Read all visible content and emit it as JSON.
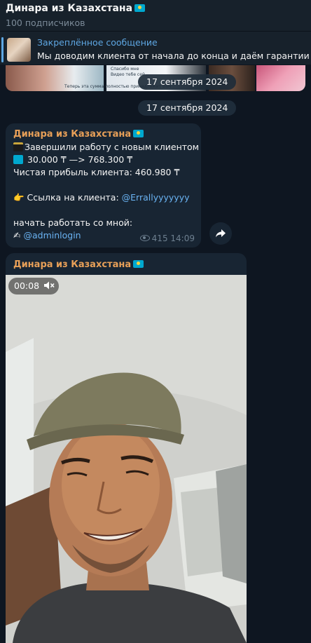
{
  "header": {
    "title": "Динара из Казахстана",
    "subscribers": "100 подписчиков"
  },
  "pinned": {
    "label": "Закреплённое сообщение",
    "text": "Мы доводим клиента от начала до конца и даём гарантии"
  },
  "album": {
    "date_badge": "17 сентября 2024",
    "snippets": [
      "Теперь эта сумма полностью принадлежит Вам",
      "Видео тебе сей",
      "Спасибо мне"
    ]
  },
  "date_separator": "17 сентября 2024",
  "message1": {
    "sender": "Динара из Казахстана",
    "line1": "Завершили работу с новым клиентом",
    "line2": "30.000 ₸  —>  768.300 ₸",
    "line3": "Чистая прибыль клиента: 460.980  ₸",
    "link_prefix": " Ссылка на клиента: ",
    "link": "@Errallyyyyyyy",
    "cta": "начать работать со мной:",
    "admin": "@adminlogin",
    "views": "415",
    "time": "14:09"
  },
  "message2": {
    "sender": "Динара из Казахстана",
    "duration": "00:08"
  },
  "colors": {
    "accent": "#5ea7e3",
    "sender": "#e8a058",
    "link": "#6ab3f3",
    "bubble": "#182533",
    "background": "#0e1621"
  }
}
